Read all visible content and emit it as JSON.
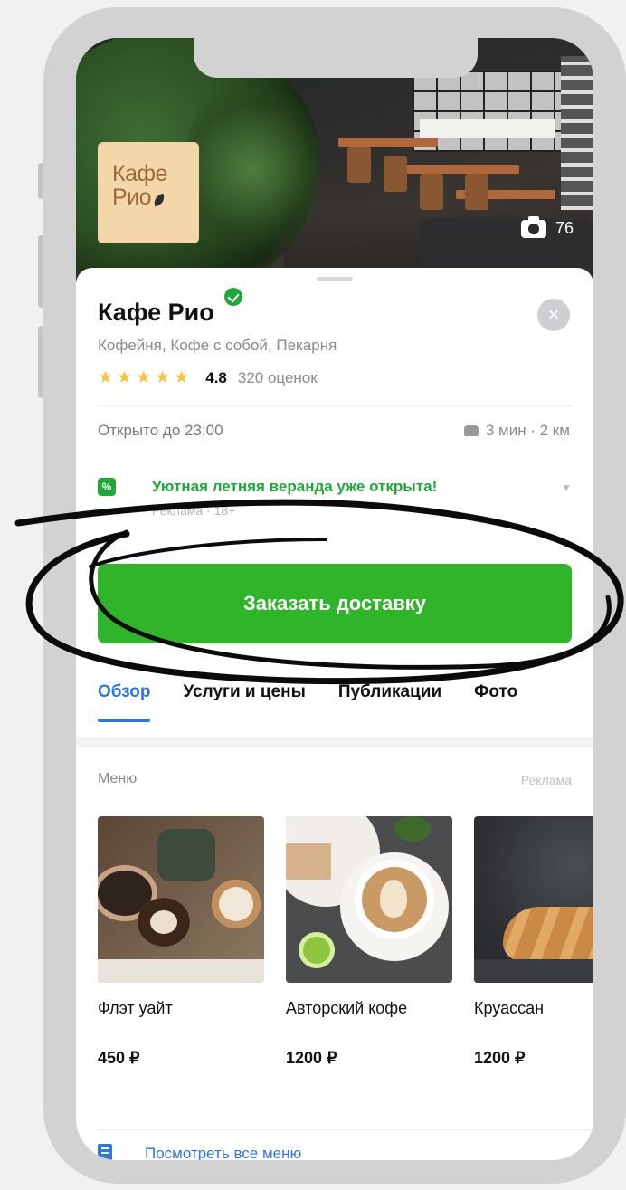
{
  "hero": {
    "logo_line1": "Кафе",
    "logo_line2": "Рио",
    "photo_count": "76"
  },
  "place": {
    "name": "Кафе Рио",
    "categories": "Кофейня, Кофе с собой, Пекарня",
    "rating": "4.8",
    "stars": 5,
    "reviews": "320 оценок",
    "hours": "Открыто до 23:00",
    "route": "3 мин · 2 км"
  },
  "promo": {
    "text": "Уютная летняя веранда уже открыта!",
    "sub": "Реклама · 18+"
  },
  "cta": {
    "label": "Заказать доставку"
  },
  "tabs": [
    "Обзор",
    "Услуги и цены",
    "Публикации",
    "Фото"
  ],
  "menu": {
    "label": "Меню",
    "ad_label": "Реклама",
    "items": [
      {
        "name": "Флэт уайт",
        "price": "450 ₽"
      },
      {
        "name": "Авторский кофе",
        "price": "1200 ₽"
      },
      {
        "name": "Круассан",
        "price": "1200 ₽"
      }
    ],
    "view_all": "Посмотреть все меню"
  },
  "colors": {
    "accent_green": "#2fb42a",
    "link_blue": "#2f76de",
    "star_yellow": "#f6c343"
  },
  "icons": [
    "camera-icon",
    "verified-icon",
    "close-icon",
    "star-icon",
    "car-icon",
    "promo-icon",
    "chevron-down-icon",
    "menu-book-icon"
  ]
}
